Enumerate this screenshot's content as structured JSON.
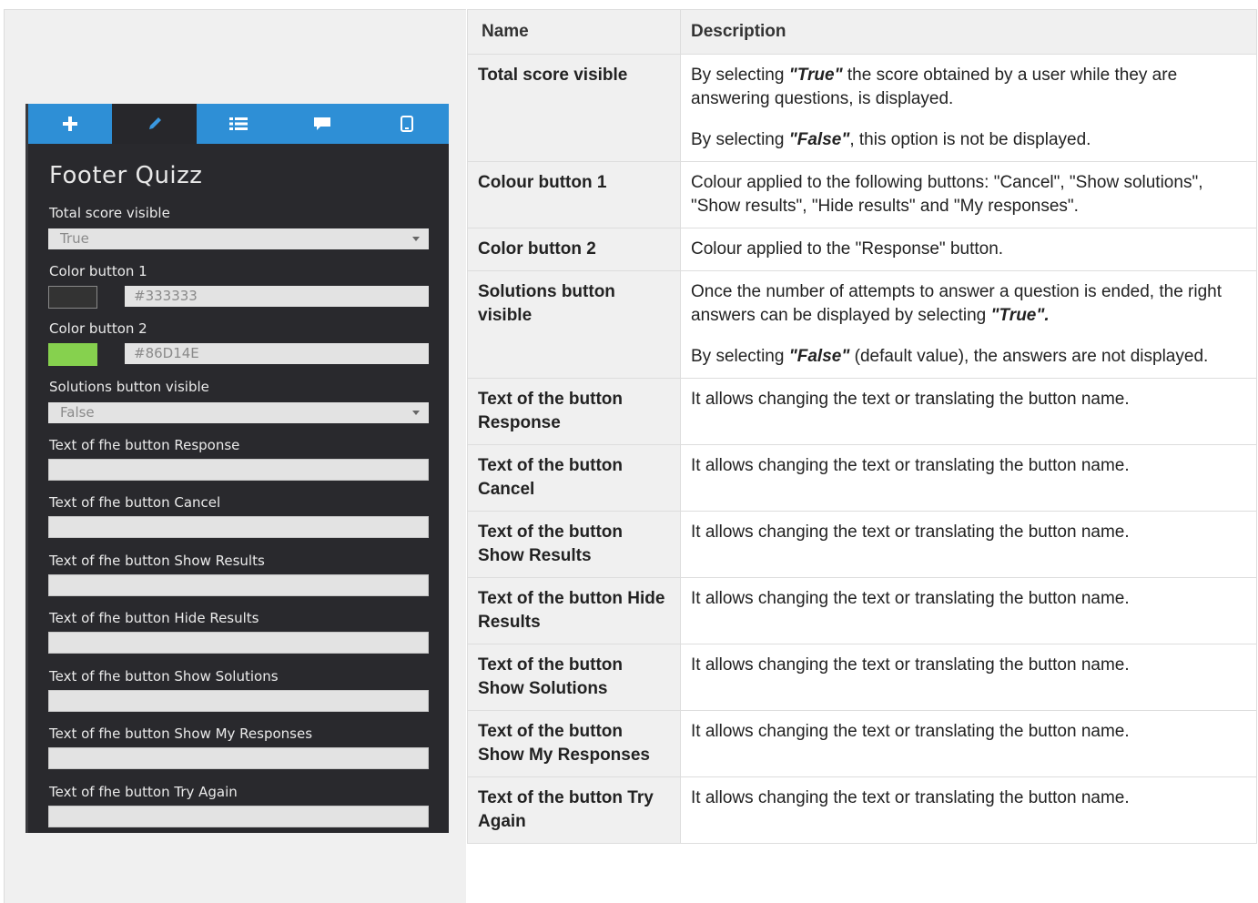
{
  "panel": {
    "tabs": [
      {
        "icon": "plus-icon"
      },
      {
        "icon": "pencil-icon"
      },
      {
        "icon": "list-icon"
      },
      {
        "icon": "comment-icon"
      },
      {
        "icon": "tablet-icon"
      }
    ],
    "active_tab_index": 1,
    "title": "Footer Quizz",
    "fields": {
      "total_score": {
        "label": "Total score visible",
        "value": "True"
      },
      "color1": {
        "label": "Color button 1",
        "swatch": "#333333",
        "value": "#333333"
      },
      "color2": {
        "label": "Color button 2",
        "swatch": "#86D14E",
        "value": "#86D14E"
      },
      "solutions": {
        "label": "Solutions button visible",
        "value": "False"
      },
      "text_response": {
        "label": "Text of fhe button Response",
        "value": ""
      },
      "text_cancel": {
        "label": "Text of fhe button Cancel",
        "value": ""
      },
      "text_show_results": {
        "label": "Text of fhe button Show Results",
        "value": ""
      },
      "text_hide_results": {
        "label": "Text of fhe button Hide Results",
        "value": ""
      },
      "text_show_solutions": {
        "label": "Text of fhe button Show Solutions",
        "value": ""
      },
      "text_show_my_responses": {
        "label": "Text of fhe button Show My Responses",
        "value": ""
      },
      "text_try_again": {
        "label": "Text of fhe button Try Again",
        "value": ""
      }
    }
  },
  "table": {
    "headers": {
      "name": "Name",
      "description": "Description"
    },
    "rows": [
      {
        "name": "Total score visible",
        "p1": {
          "a": "By selecting ",
          "kw": "\"True\"",
          "b": " the score obtained by a user while they are answering questions, is displayed."
        },
        "p2": {
          "a": "By selecting ",
          "kw": "\"False\"",
          "b": ", this option is not be displayed."
        }
      },
      {
        "name": "Colour button 1",
        "desc": "Colour applied to the following buttons: \"Cancel\", \"Show solutions\", \"Show results\", \"Hide results\" and \"My responses\"."
      },
      {
        "name": "Color button 2",
        "desc": "Colour applied to the \"Response\" button."
      },
      {
        "name": "Solutions button visible",
        "p1": {
          "a": "Once the number of attempts to answer a question is ended, the right answers can be displayed by selecting ",
          "kw": "\"True\".",
          "b": ""
        },
        "p2": {
          "a": "By selecting ",
          "kw": "\"False\"",
          "b": " (default value), the answers are not displayed."
        }
      },
      {
        "name": "Text of the button Response",
        "desc": "It allows changing the text or translating the button name."
      },
      {
        "name": "Text of the button Cancel",
        "desc": "It allows changing the text or translating the button name."
      },
      {
        "name": "Text of the button Show Results",
        "desc": "It allows changing the text or translating the button name."
      },
      {
        "name": "Text of the button Hide Results",
        "desc": "It allows changing the text or translating the button name."
      },
      {
        "name": "Text of the button Show Solutions",
        "desc": "It allows changing the text or translating the button name."
      },
      {
        "name": "Text of the button Show My Responses",
        "desc": "It allows changing the text or translating the button name."
      },
      {
        "name": "Text of the button Try Again",
        "desc": "It allows changing the text or translating the button name."
      }
    ]
  }
}
